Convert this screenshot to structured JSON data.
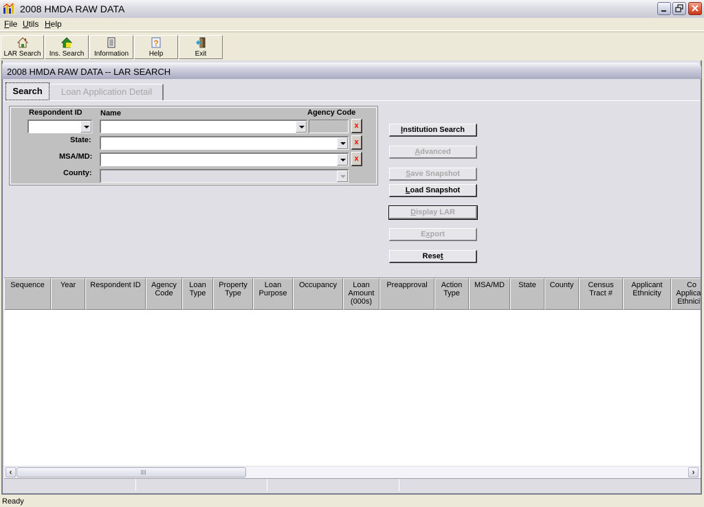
{
  "window": {
    "title": "2008 HMDA RAW DATA",
    "controls": [
      "minimize",
      "restore",
      "close"
    ]
  },
  "menu": [
    {
      "label": "File",
      "mnemonic": "F",
      "rest": "ile"
    },
    {
      "label": "Utils",
      "mnemonic": "U",
      "rest": "tils"
    },
    {
      "label": "Help",
      "mnemonic": "H",
      "rest": "elp"
    }
  ],
  "toolbar": [
    {
      "label": "LAR Search",
      "icon": "house-icon"
    },
    {
      "label": "Ins. Search",
      "icon": "green-house-icon"
    },
    {
      "label": "Information",
      "icon": "notebook-icon"
    },
    {
      "label": "Help",
      "icon": "help-document-icon"
    },
    {
      "label": "Exit",
      "icon": "exit-door-icon"
    }
  ],
  "child_window": {
    "title": "2008 HMDA RAW DATA -- LAR SEARCH"
  },
  "tabs": [
    {
      "label": "Search",
      "active": true,
      "enabled": true
    },
    {
      "label": "Loan Application Detail",
      "active": false,
      "enabled": false
    }
  ],
  "criteria": {
    "respondent_id_label": "Respondent ID",
    "respondent_id_value": "",
    "name_label": "Name",
    "name_value": "",
    "agency_code_label": "Agency Code",
    "agency_code_value": "",
    "state_label": "State:",
    "state_value": "",
    "msamd_label": "MSA/MD:",
    "msamd_value": "",
    "county_label": "County:",
    "county_value": "",
    "clear_label": "x"
  },
  "actions": [
    {
      "label": "Institution Search",
      "mnemonic_index": 0,
      "enabled": true
    },
    {
      "label": "Advanced",
      "mnemonic_index": 0,
      "enabled": false
    },
    {
      "label": "Save Snapshot",
      "mnemonic_index": 0,
      "enabled": false
    },
    {
      "label": "Load Snapshot",
      "mnemonic_index": 0,
      "enabled": true
    },
    {
      "label": "Display LAR",
      "mnemonic_index": 0,
      "enabled": false,
      "focused": true
    },
    {
      "label": "Export",
      "mnemonic_index": 1,
      "enabled": false
    },
    {
      "label": "Reset",
      "mnemonic_index": 4,
      "enabled": true
    }
  ],
  "grid": {
    "columns": [
      "Sequence",
      "Year",
      "Respondent ID",
      "Agency\nCode",
      "Loan\nType",
      "Property\nType",
      "Loan\nPurpose",
      "Occupancy",
      "Loan\nAmount\n(000s)",
      "Preapproval",
      "Action\nType",
      "MSA/MD",
      "State",
      "County",
      "Census\nTract #",
      "Applicant\nEthnicity",
      "Co Applicant\nEthnicity"
    ],
    "rows": []
  },
  "status": {
    "text": "Ready"
  }
}
